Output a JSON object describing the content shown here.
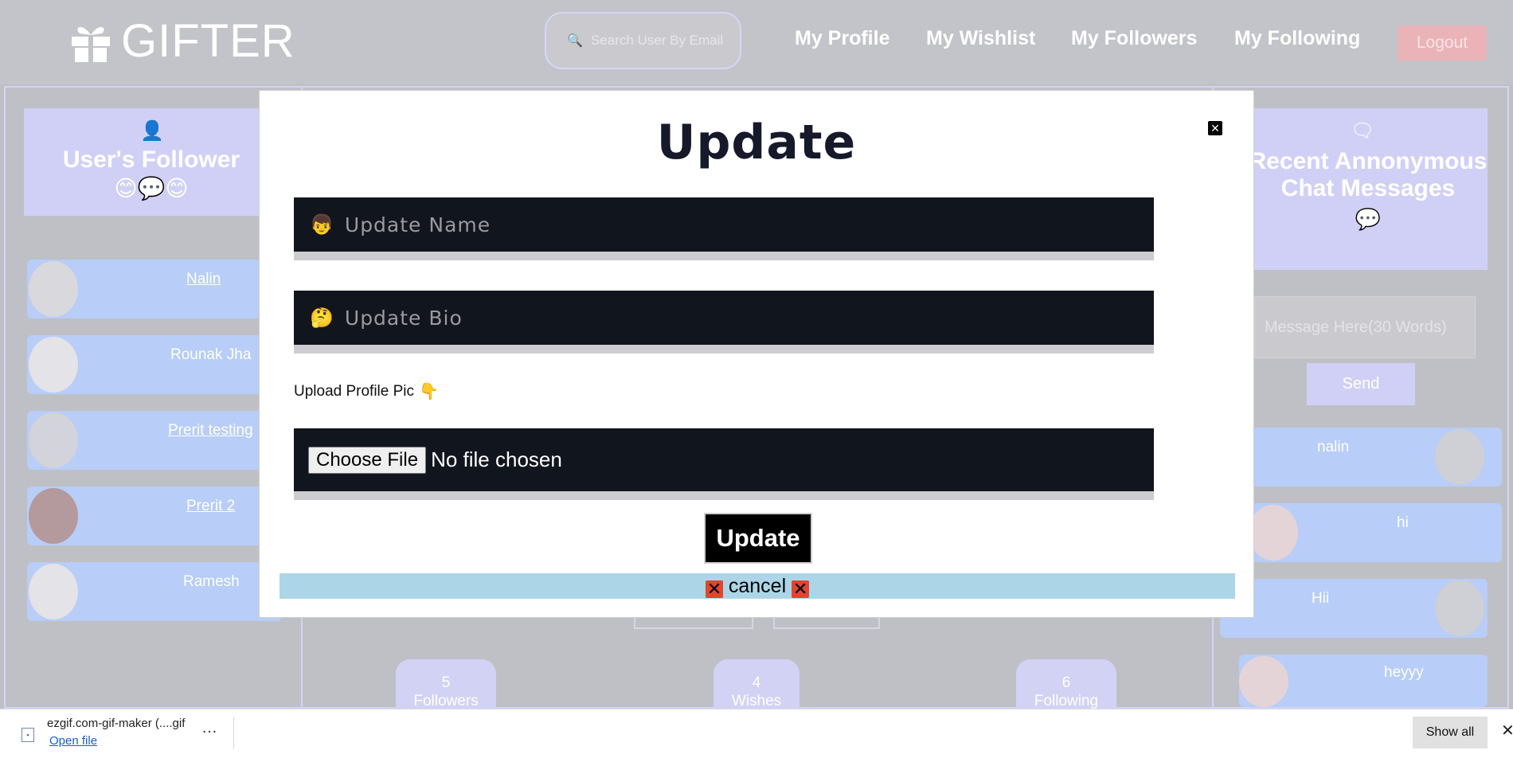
{
  "header": {
    "brand": "GIFTER",
    "search_placeholder": "Search User By Email",
    "nav": [
      "My Profile",
      "My Wishlist",
      "My Followers",
      "My Following"
    ],
    "logout": "Logout"
  },
  "left_panel": {
    "title": "User's Follower",
    "emojis": "😊💬😊",
    "followers": [
      "Nalin",
      "Rounak Jha",
      "Prerit testing",
      "Prerit 2",
      "Ramesh"
    ]
  },
  "center": {
    "stats": [
      {
        "count": "5",
        "label": "Followers"
      },
      {
        "count": "4",
        "label": "Wishes"
      },
      {
        "count": "6",
        "label": "Following"
      }
    ]
  },
  "right_panel": {
    "title": "Recent Annonymous Chat Messages",
    "message_placeholder": "Message Here(30 Words)",
    "send": "Send",
    "messages": [
      "nalin",
      "hi",
      "Hii",
      "heyyy"
    ]
  },
  "modal": {
    "title": "Update",
    "name_placeholder": "Update Name",
    "bio_placeholder": "Update Bio",
    "upload_label": "Upload Profile Pic",
    "choose_file": "Choose File",
    "no_file": "No file chosen",
    "update_button": "Update",
    "cancel": "cancel",
    "name_emoji": "👦",
    "bio_emoji": "🤔",
    "hand_emoji": "👇"
  },
  "download_bar": {
    "file_name": "ezgif.com-gif-maker (....gif",
    "open_file": "Open file",
    "more": "…",
    "show_all": "Show all"
  }
}
